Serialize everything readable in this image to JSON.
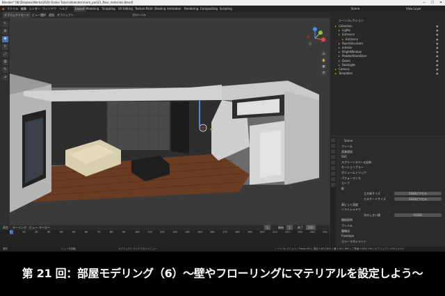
{
  "window": {
    "title": "Blender* [W:\\Dropbox\\Works\\2024 Online Tutorial\\blender\\room_part21_floor_materials.blend]",
    "controls": [
      "—",
      "☐",
      "✕"
    ]
  },
  "menubar": {
    "items": [
      "ファイル",
      "編集",
      "レンダー",
      "ウィンドウ",
      "ヘルプ"
    ],
    "workspaces": [
      "Layout",
      "Modeling",
      "Sculpting",
      "UV Editing",
      "Texture Paint",
      "Shading",
      "Animation",
      "Rendering",
      "Compositing",
      "Scripting"
    ],
    "active_workspace": "Layout",
    "scene_label": "Scene",
    "view_layer_label": "View Layer"
  },
  "viewport_header": {
    "items": [
      "オブジェクトモード",
      "ビュー",
      "選択",
      "追加",
      "オブジェクト"
    ],
    "transform": "グローバル"
  },
  "tools": [
    {
      "icon": "select-icon",
      "glyph": "↖",
      "active": false
    },
    {
      "icon": "cursor-icon",
      "glyph": "⊕",
      "active": false
    },
    {
      "icon": "move-icon",
      "glyph": "✥",
      "active": true
    },
    {
      "icon": "rotate-icon",
      "glyph": "↻",
      "active": false
    },
    {
      "icon": "scale-icon",
      "glyph": "⤢",
      "active": false
    },
    {
      "icon": "transform-icon",
      "glyph": "⧉",
      "active": false
    },
    {
      "icon": "annotate-icon",
      "glyph": "✎",
      "active": false
    },
    {
      "icon": "measure-icon",
      "glyph": "📐",
      "active": false
    }
  ],
  "outliner": {
    "header": "シーンコレクション",
    "rows": [
      {
        "name": "Collection",
        "indent": 1
      },
      {
        "name": "Lights",
        "indent": 2
      },
      {
        "name": "Entrance",
        "indent": 2
      },
      {
        "name": "Entrance",
        "indent": 3
      },
      {
        "name": "RoomStructure",
        "indent": 2
      },
      {
        "name": "Interior",
        "indent": 2
      },
      {
        "name": "BrightWindow",
        "indent": 2
      },
      {
        "name": "PowderRoomDoor",
        "indent": 2
      },
      {
        "name": "Doors",
        "indent": 2
      },
      {
        "name": "RectLight",
        "indent": 2
      },
      {
        "name": "Camera",
        "indent": 1
      },
      {
        "name": "Templates",
        "indent": 1
      }
    ]
  },
  "properties": {
    "scene": "Scene",
    "rows": [
      {
        "label": "フレーム",
        "value": ""
      },
      {
        "label": "背景透過",
        "value": ""
      },
      {
        "label": "SSS",
        "value": ""
      },
      {
        "label": "スクリーンスペース反射",
        "value": ""
      },
      {
        "label": "モーションブラー",
        "value": ""
      },
      {
        "label": "ボリュームトリック",
        "value": ""
      },
      {
        "label": "パフォーマンス",
        "value": ""
      },
      {
        "label": "カーブ",
        "value": ""
      },
      {
        "label": "影",
        "value": ""
      },
      {
        "label": "立方体サイズ",
        "value": "2048ピクセル"
      },
      {
        "label": "カスケードサイズ",
        "value": "1024ピクセル"
      },
      {
        "label": "高ビット深度",
        "value": ""
      },
      {
        "label": "ソフトシャドウ",
        "value": ""
      },
      {
        "label": "光のしきい値",
        "value": "0.010"
      },
      {
        "label": "間接照明",
        "value": ""
      },
      {
        "label": "フィルム",
        "value": ""
      },
      {
        "label": "簡略化",
        "value": ""
      },
      {
        "label": "Freestyle",
        "value": ""
      },
      {
        "label": "カラーマネジメント",
        "value": ""
      }
    ]
  },
  "timeline": {
    "header": [
      "再生",
      "キーイング",
      "ビュー",
      "マーカー"
    ],
    "current_frame": "1",
    "start_label": "開始",
    "start": "1",
    "end_label": "終了",
    "end": "250",
    "ticks": [
      "0",
      "10",
      "20",
      "30",
      "40",
      "50",
      "60",
      "70",
      "80",
      "90",
      "100",
      "110",
      "120",
      "130",
      "140",
      "150",
      "160",
      "170",
      "180",
      "190",
      "200",
      "210",
      "220",
      "230",
      "240",
      "250"
    ]
  },
  "statusbar": {
    "left": "選択",
    "mid1": "ビューを回転",
    "mid2": "オブジェクトコンテクストメニュー",
    "right": "シーンコレクション | Plane.001 | 頂点:1,812,820 | 面:1,822,664 | 三角面:3,604,748 | オブジェクト:1/35 | 4.0.2"
  },
  "caption": {
    "text": "第 21 回：部屋モデリング（6）〜壁やフローリングにマテリアルを設定しよう〜"
  },
  "colors": {
    "accent": "#4772b3",
    "x_axis": "#e24c4c",
    "y_axis": "#8cc73f",
    "z_axis": "#4a8af4"
  }
}
